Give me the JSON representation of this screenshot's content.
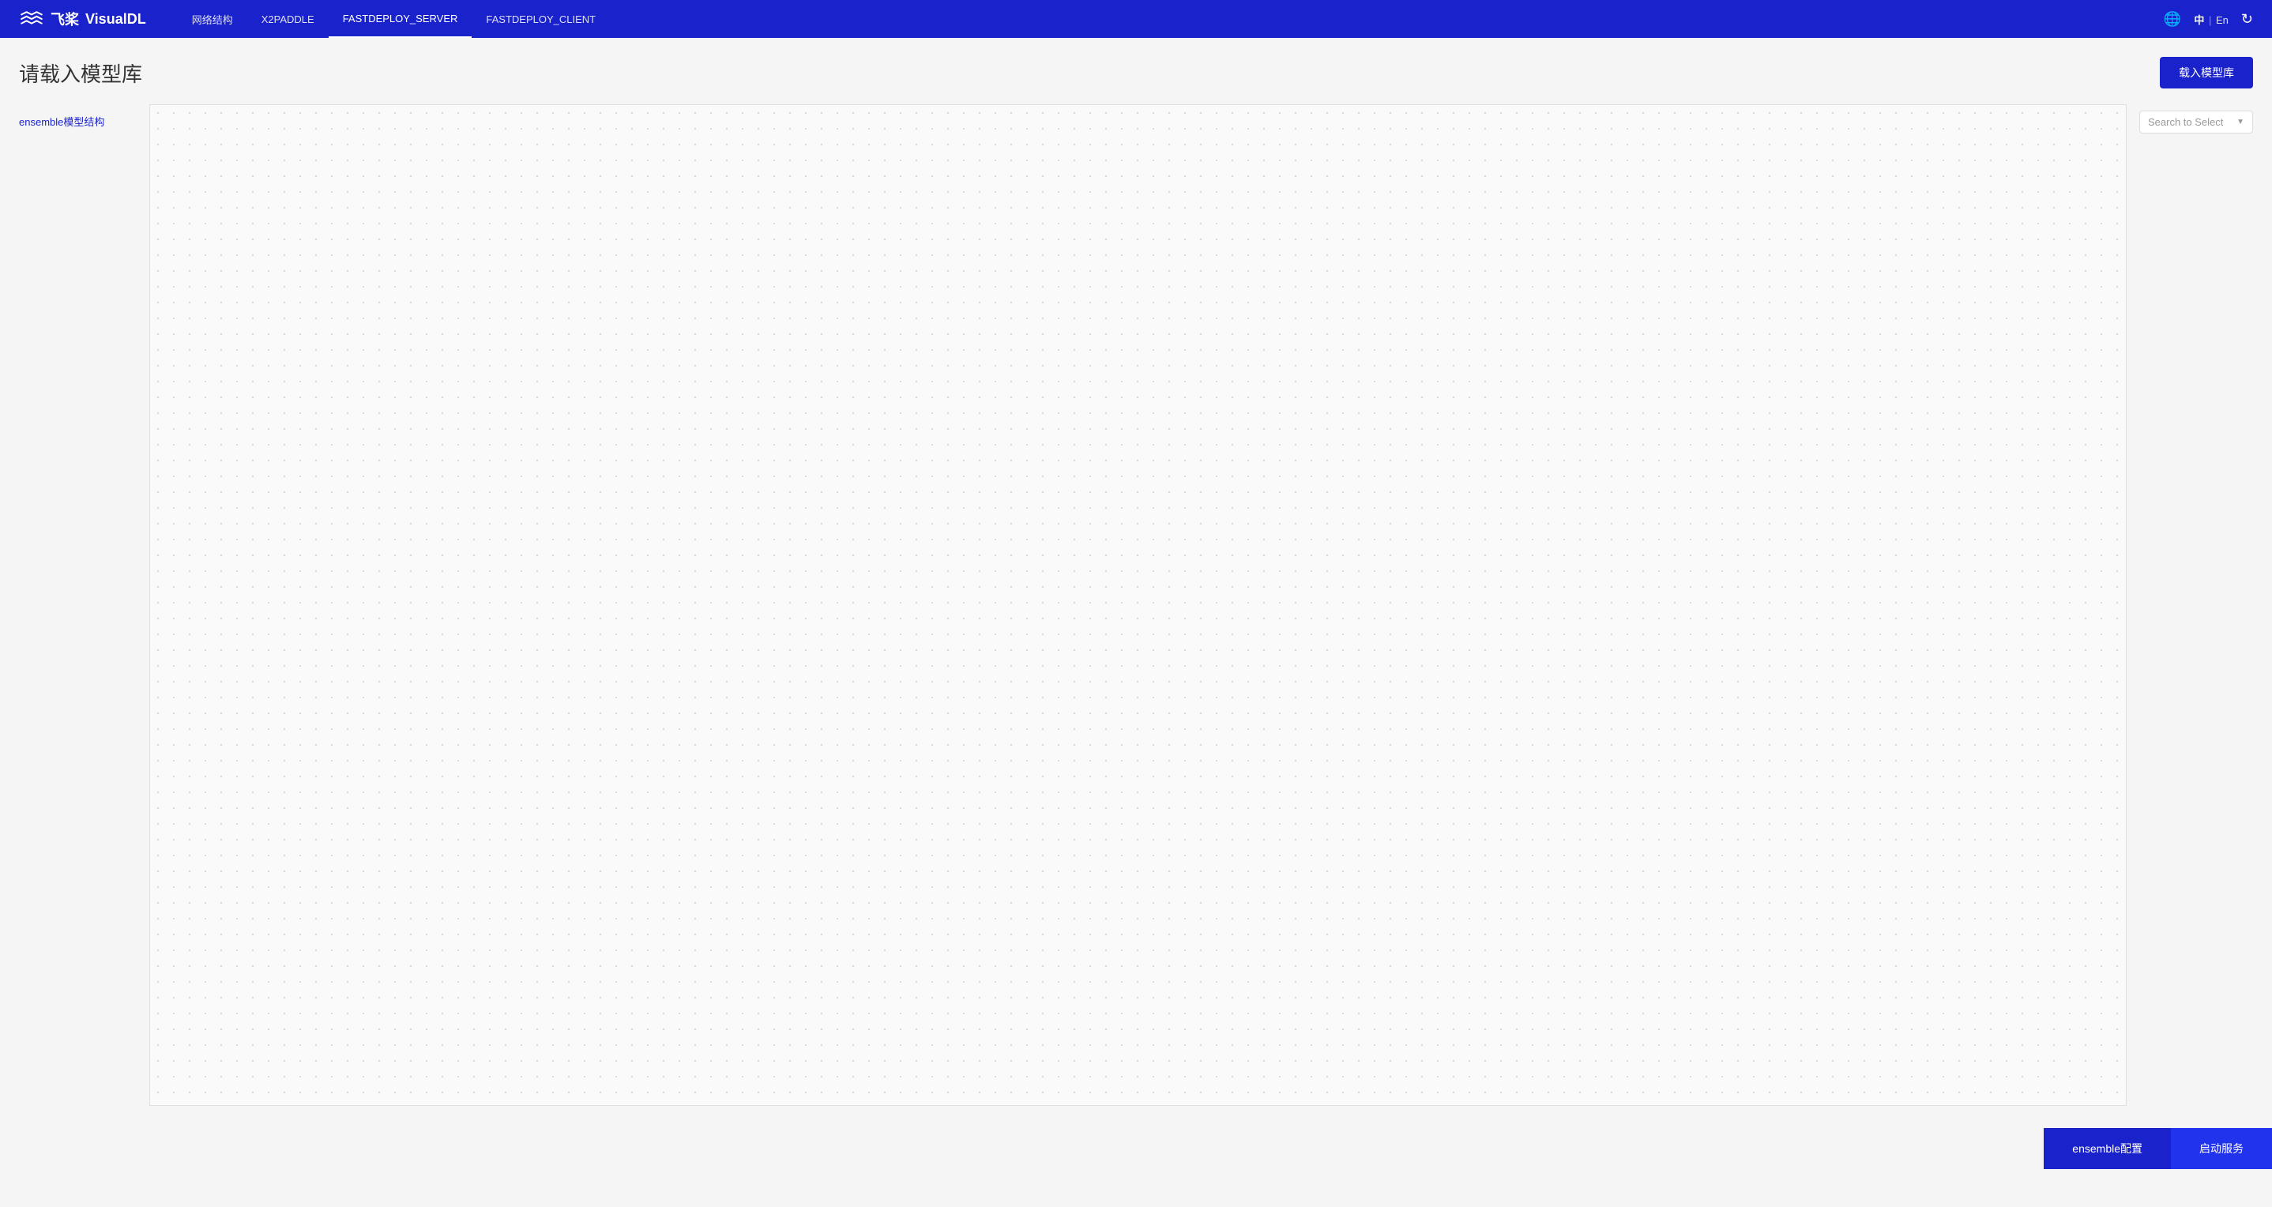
{
  "app": {
    "logo_text": "VisualDL",
    "logo_icon": "飞桨"
  },
  "navbar": {
    "items": [
      {
        "label": "网络结构",
        "active": false
      },
      {
        "label": "X2PADDLE",
        "active": false
      },
      {
        "label": "FASTDEPLOY_SERVER",
        "active": true
      },
      {
        "label": "FASTDEPLOY_CLIENT",
        "active": false
      }
    ],
    "lang_zh": "中",
    "lang_en": "En",
    "lang_separator": "|"
  },
  "page": {
    "title": "请载入模型库",
    "load_button_label": "载入模型库"
  },
  "sidebar": {
    "item_label": "ensemble模型结构"
  },
  "search_select": {
    "placeholder": "Search to Select"
  },
  "bottom_buttons": {
    "secondary_label": "ensemble配置",
    "primary_label": "启动服务"
  }
}
